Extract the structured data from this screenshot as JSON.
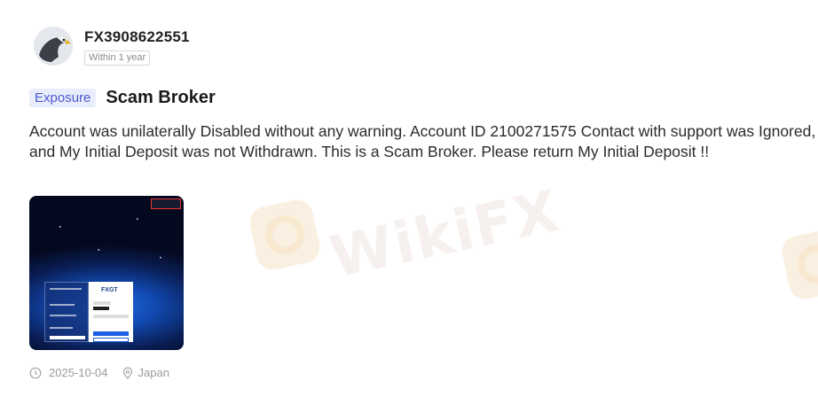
{
  "post": {
    "username": "FX3908622551",
    "time_badge": "Within 1 year",
    "tag": "Exposure",
    "title": "Scam Broker",
    "body": "Account was unilaterally Disabled without any warning. Account ID 2100271575 Contact with support was Ignored, and My Initial Deposit was not Withdrawn. This is a Scam Broker. Please return My Initial Deposit !!",
    "date": "2025-10-04",
    "location": "Japan"
  },
  "watermark": {
    "text": "WikiFX"
  },
  "thumbnail": {
    "logo_text": "FXGT"
  },
  "colors": {
    "tag_bg": "#e9edfb",
    "tag_text": "#4a5bcf",
    "meta_text": "#9a9a9a"
  },
  "icons": {
    "avatar": "eagle-avatar-icon",
    "date": "clock-icon",
    "location": "location-pin-icon"
  }
}
